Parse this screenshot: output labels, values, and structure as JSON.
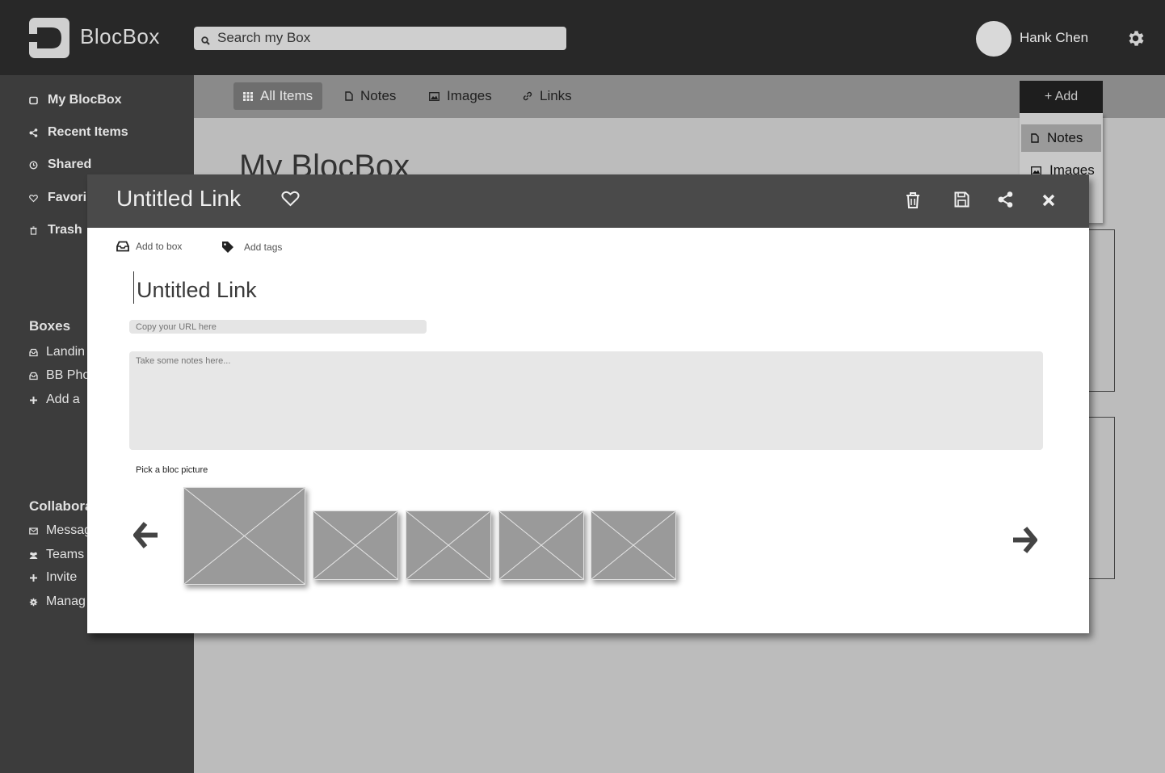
{
  "app": {
    "name": "BlocBox",
    "search_placeholder": "Search my Box",
    "user_name": "Hank Chen"
  },
  "sidebar": {
    "nav": [
      {
        "label": "My BlocBox",
        "icon": "box-icon"
      },
      {
        "label": "Recent Items",
        "icon": "share-icon"
      },
      {
        "label": "Shared",
        "icon": "clock-icon"
      },
      {
        "label": "Favori",
        "icon": "heart-icon"
      },
      {
        "label": "Trash",
        "icon": "trash-icon"
      }
    ],
    "boxes_heading": "Boxes",
    "boxes": [
      {
        "label": "Landin",
        "icon": "inbox-icon"
      },
      {
        "label": "BB Pho",
        "icon": "inbox-icon"
      },
      {
        "label": "Add a",
        "icon": "plus-icon"
      }
    ],
    "collab_heading": "Collabora",
    "collab": [
      {
        "label": "Messag",
        "icon": "envelope-icon"
      },
      {
        "label": "Teams",
        "icon": "users-icon"
      },
      {
        "label": "Invite",
        "icon": "plus-icon"
      },
      {
        "label": "Manag",
        "icon": "cog-icon"
      }
    ]
  },
  "tabs": [
    {
      "label": "All Items",
      "icon": "grid-icon",
      "active": true
    },
    {
      "label": "Notes",
      "icon": "document-icon"
    },
    {
      "label": "Images",
      "icon": "image-icon"
    },
    {
      "label": "Links",
      "icon": "link-icon"
    }
  ],
  "add_menu": {
    "button_label": "+ Add",
    "items": [
      {
        "label": "Notes",
        "icon": "document-icon",
        "selected": true
      },
      {
        "label": "Images",
        "icon": "image-icon"
      }
    ]
  },
  "page": {
    "title": "My BlocBox"
  },
  "modal": {
    "title": "Untitled Link",
    "add_to_box": "Add to box",
    "add_tags": "Add tags",
    "link_title_value": "Untitled Link",
    "url_placeholder": "Copy your URL here",
    "notes_placeholder": "Take some notes here...",
    "pick_label": "Pick a bloc picture",
    "thumbnail_count": 5
  },
  "colors": {
    "topbar": "#282828",
    "sidebar": "#3c3c3c",
    "tabsbar": "#8a8a8a",
    "modal_header": "#4a4a4a",
    "content_bg": "#bcbcbc"
  }
}
